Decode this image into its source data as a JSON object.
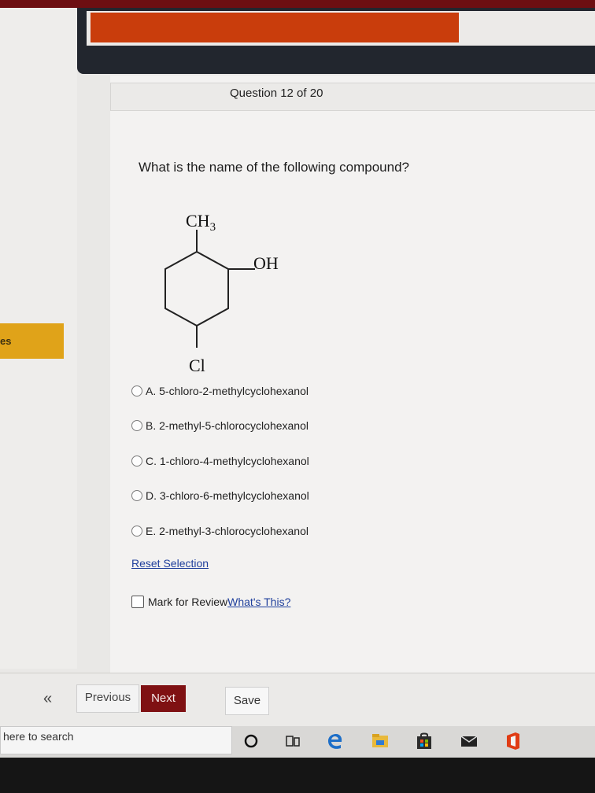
{
  "question": {
    "counter": "Question 12 of 20",
    "text": "What is the name of the following compound?"
  },
  "molecule": {
    "top_label": "CH3",
    "right_label": "OH",
    "bottom_label": "Cl"
  },
  "options": [
    {
      "label": "A. 5-chloro-2-methylcyclohexanol",
      "selected": false
    },
    {
      "label": "B. 2-methyl-5-chlorocyclohexanol",
      "selected": false
    },
    {
      "label": "C. 1-chloro-4-methylcyclohexanol",
      "selected": false
    },
    {
      "label": "D. 3-chloro-6-methylcyclohexanol",
      "selected": false
    },
    {
      "label": "E. 2-methyl-3-chlorocyclohexanol",
      "selected": false
    }
  ],
  "reset_selection": "Reset Selection",
  "mark_review": {
    "label": "Mark for Review",
    "link": "What's This?",
    "checked": false
  },
  "sidebar": {
    "tab_label": "es"
  },
  "footer": {
    "collapse": "«",
    "previous": "Previous",
    "next": "Next",
    "save": "Save"
  },
  "taskbar": {
    "search_placeholder": "here to search",
    "icons": [
      "cortana-icon",
      "task-view-icon",
      "edge-icon",
      "file-explorer-icon",
      "store-icon",
      "mail-icon",
      "office-icon"
    ]
  },
  "colors": {
    "accent_orange": "#c93d0c",
    "next_button": "#7f1113",
    "side_tab": "#e0a319",
    "link": "#1f3f9c"
  }
}
